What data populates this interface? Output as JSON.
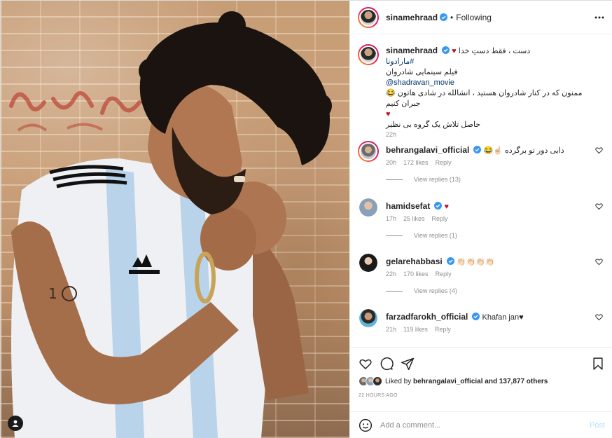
{
  "post": {
    "username": "sinamehraad",
    "follow_state": "Following",
    "separator": "•"
  },
  "caption": {
    "username": "sinamehraad",
    "line1": "دست ، فقط دستِ خدا",
    "hashtag": "#مارادونا",
    "line3": "فیلم سینمایی شادروان",
    "mention": "@shadravan_movie",
    "line5": "ممنون که در کنار شادروان هستید ، انشالله در شادی هاتون جبران کنیم",
    "line7": "حاصل تلاش یک گروه بی نظیر",
    "time": "22h"
  },
  "comments": [
    {
      "username": "behrangalavi_official",
      "verified": true,
      "text": "دایی دور تو برگرده ☝🏻😂",
      "time": "20h",
      "likes": "172 likes",
      "reply": "Reply",
      "replies": "View replies (13)"
    },
    {
      "username": "hamidsefat",
      "verified": true,
      "text": "♥",
      "time": "17h",
      "likes": "25 likes",
      "reply": "Reply",
      "replies": "View replies (1)"
    },
    {
      "username": "gelarehabbasi",
      "verified": true,
      "text": "👏🏻👏🏻👏🏻👏🏻",
      "time": "22h",
      "likes": "170 likes",
      "reply": "Reply",
      "replies": "View replies (4)"
    },
    {
      "username": "farzadfarokh_official",
      "verified": true,
      "text": "Khafan jan♥",
      "time": "21h",
      "likes": "119 likes",
      "reply": "Reply",
      "replies": ""
    }
  ],
  "likes": {
    "liked_by_prefix": "Liked by",
    "liked_by_user": "behrangalavi_official",
    "and_others": "and 137,877 others"
  },
  "timestamp": "22 HOURS AGO",
  "add_comment": {
    "placeholder": "Add a comment...",
    "post_label": "Post"
  },
  "colors": {
    "verified_blue": "#3897f0",
    "heart_red": "#c8102e",
    "link_blue": "#00376b",
    "muted_gray": "#8e8e8e",
    "post_disabled": "#b2dffc"
  },
  "icons": [
    "verified-badge-icon",
    "more-options-icon",
    "heart-icon",
    "comment-icon",
    "share-icon",
    "bookmark-icon",
    "emoji-icon",
    "user-tag-icon"
  ]
}
